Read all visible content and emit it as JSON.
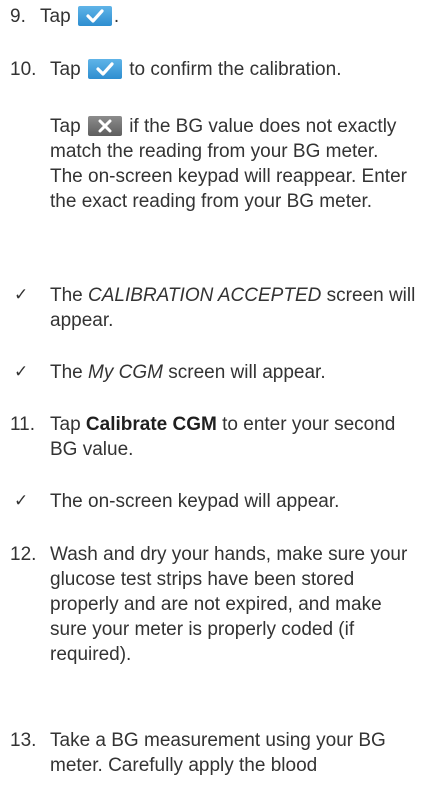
{
  "steps": {
    "s9": {
      "num": "9.",
      "pre": "Tap",
      "post": "."
    },
    "s10": {
      "num": "10.",
      "pre": "Tap",
      "post": "to confirm the calibration."
    },
    "s10_note": {
      "pre": "Tap",
      "post": "if the BG value does not exactly match the reading from your BG meter. The on-screen keypad will reappear. Enter the exact reading from your BG meter."
    },
    "r1": {
      "pre": "The",
      "em": "CALIBRATION ACCEPTED",
      "post": "screen will appear."
    },
    "r2": {
      "pre": "The",
      "em": "My CGM",
      "post": "screen will appear."
    },
    "s11": {
      "num": "11.",
      "pre": "Tap",
      "bold": "Calibrate CGM",
      "post": "to enter your second BG value."
    },
    "r3": {
      "text": "The on-screen keypad will appear."
    },
    "s12": {
      "num": "12.",
      "text": "Wash and dry your hands, make sure your glucose test strips have been stored properly and are not expired, and make sure your meter is properly coded (if required)."
    },
    "s13": {
      "num": "13.",
      "text": "Take a BG measurement using your BG meter. Carefully apply the blood"
    }
  },
  "icons": {
    "confirm": "check-icon",
    "cancel": "close-icon",
    "result_marker": "checkmark"
  },
  "colors": {
    "confirm_button": "#3a9ad9",
    "cancel_button": "#757575",
    "text": "#333333"
  }
}
